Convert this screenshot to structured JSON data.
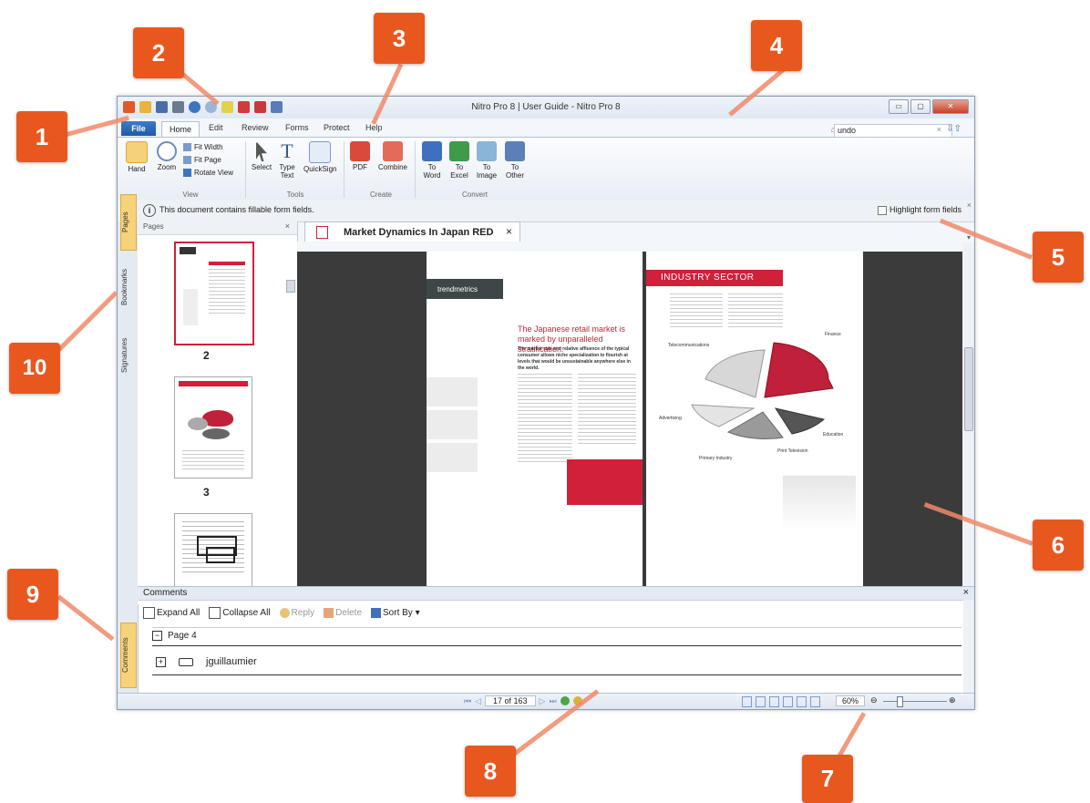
{
  "window": {
    "title": "Nitro Pro 8 | User Guide - Nitro Pro 8",
    "min_label": "▭",
    "max_label": "▢",
    "close_label": "✕"
  },
  "tabs": [
    "File",
    "Home",
    "Edit",
    "Review",
    "Forms",
    "Protect",
    "Help"
  ],
  "search": {
    "value": "undo",
    "clear": "×"
  },
  "ribbon": {
    "view": {
      "hand": "Hand",
      "zoom": "Zoom",
      "fit_width": "Fit Width",
      "fit_page": "Fit Page",
      "rotate": "Rotate View",
      "label": "View"
    },
    "tools": {
      "select": "Select",
      "type_text": "Type Text",
      "quicksign": "QuickSign",
      "label": "Tools"
    },
    "create": {
      "pdf": "PDF",
      "combine": "Combine",
      "label": "Create"
    },
    "convert": {
      "to_word": "To Word",
      "to_excel": "To Excel",
      "to_image": "To Image",
      "to_other": "To Other",
      "label": "Convert"
    }
  },
  "infobar": {
    "message": "This document contains fillable form fields.",
    "highlight_label": "Highlight form fields"
  },
  "side_tabs": [
    "Pages",
    "Bookmarks",
    "Signatures"
  ],
  "pages_panel": {
    "title": "Pages",
    "page_numbers": [
      "2",
      "3"
    ]
  },
  "document": {
    "tab_title": "Market Dynamics In Japan RED",
    "logo": "trendmetrics",
    "heading": "The Japanese retail market is marked by unparalleled stratification.",
    "subheading": "The market size and relative affluence of the typical consumer allows niche specialization to flourish at levels that would be unsustainable anywhere else in the world.",
    "right_banner": "INDUSTRY SECTOR",
    "pie_labels": [
      "Finance",
      "Telecommunications",
      "Advertising",
      "Education",
      "Print Television",
      "Primary Industry"
    ]
  },
  "comments": {
    "title": "Comments",
    "toolbar": {
      "expand": "Expand All",
      "collapse": "Collapse All",
      "reply": "Reply",
      "delete": "Delete",
      "sort": "Sort By"
    },
    "group": "Page 4",
    "author": "jguillaumier",
    "side_tab": "Comments"
  },
  "statusbar": {
    "page": "17 of 163",
    "zoom": "60%"
  },
  "callouts": [
    "1",
    "2",
    "3",
    "4",
    "5",
    "6",
    "7",
    "8",
    "9",
    "10"
  ],
  "colors": {
    "accent": "#e8581e",
    "brand_red": "#d0203a",
    "file_tab": "#1e5aa8"
  }
}
